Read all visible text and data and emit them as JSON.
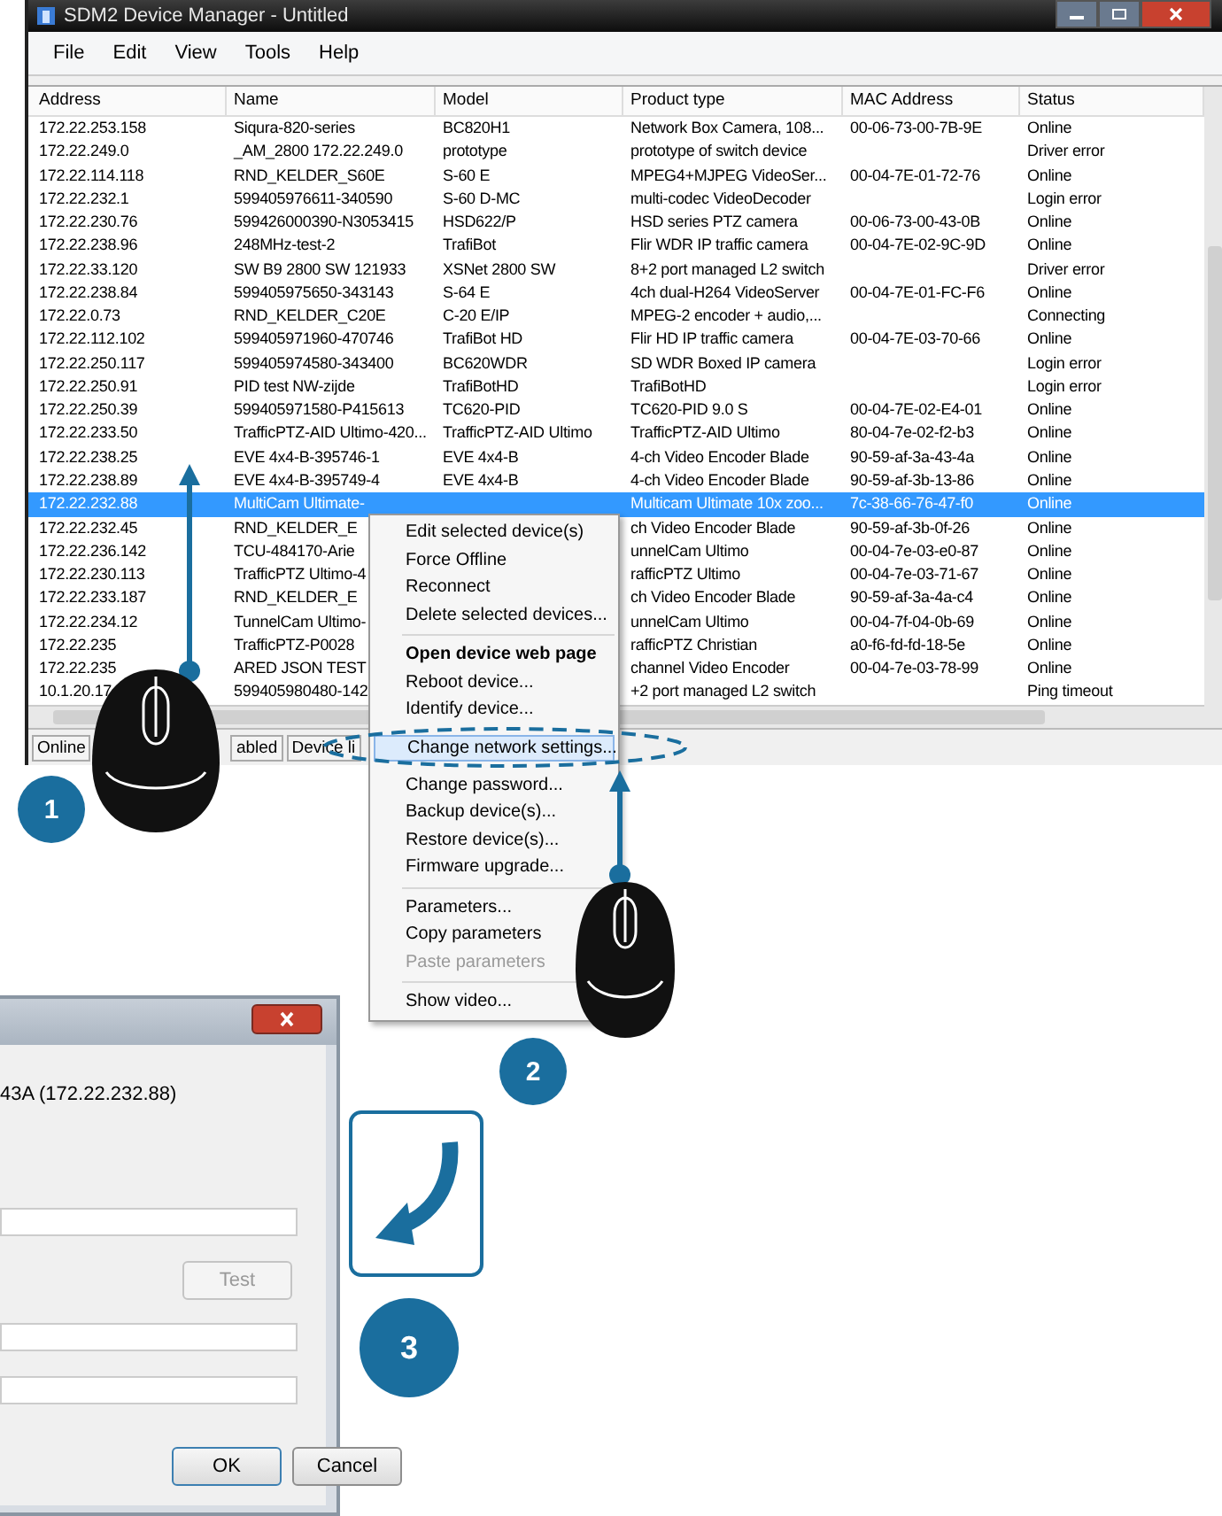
{
  "window": {
    "title": "SDM2 Device Manager - Untitled"
  },
  "menu": [
    "File",
    "Edit",
    "View",
    "Tools",
    "Help"
  ],
  "table": {
    "columns": [
      "Address",
      "Name",
      "Model",
      "Product type",
      "MAC Address",
      "Status"
    ],
    "rows": [
      {
        "cells": [
          "172.22.253.158",
          "Siqura-820-series",
          "BC820H1",
          "Network Box Camera, 108...",
          "00-06-73-00-7B-9E",
          "Online"
        ],
        "selected": false
      },
      {
        "cells": [
          "172.22.249.0",
          "_AM_2800  172.22.249.0",
          "prototype",
          "prototype of switch device",
          null,
          "Driver error"
        ],
        "selected": false
      },
      {
        "cells": [
          "172.22.114.118",
          "RND_KELDER_S60E",
          "S-60 E",
          "MPEG4+MJPEG VideoSer...",
          "00-04-7E-01-72-76",
          "Online"
        ],
        "selected": false
      },
      {
        "cells": [
          "172.22.232.1",
          "599405976611-340590",
          "S-60 D-MC",
          "multi-codec VideoDecoder",
          null,
          "Login error"
        ],
        "selected": false
      },
      {
        "cells": [
          "172.22.230.76",
          "599426000390-N3053415",
          "HSD622/P",
          "HSD series PTZ camera",
          "00-06-73-00-43-0B",
          "Online"
        ],
        "selected": false
      },
      {
        "cells": [
          "172.22.238.96",
          "248MHz-test-2",
          "TrafiBot",
          "Flir WDR IP traffic camera",
          "00-04-7E-02-9C-9D",
          "Online"
        ],
        "selected": false
      },
      {
        "cells": [
          "172.22.33.120",
          "SW B9 2800 SW 121933",
          "XSNet 2800 SW",
          "8+2 port managed L2 switch",
          null,
          "Driver error"
        ],
        "selected": false
      },
      {
        "cells": [
          "172.22.238.84",
          "599405975650-343143",
          "S-64 E",
          "4ch dual-H264 VideoServer",
          "00-04-7E-01-FC-F6",
          "Online"
        ],
        "selected": false
      },
      {
        "cells": [
          "172.22.0.73",
          "RND_KELDER_C20E",
          "C-20 E/IP",
          "MPEG-2 encoder + audio,...",
          null,
          "Connecting"
        ],
        "selected": false
      },
      {
        "cells": [
          "172.22.112.102",
          "599405971960-470746",
          "TrafiBot HD",
          "Flir HD IP traffic camera",
          "00-04-7E-03-70-66",
          "Online"
        ],
        "selected": false
      },
      {
        "cells": [
          "172.22.250.117",
          "599405974580-343400",
          "BC620WDR",
          "SD WDR Boxed IP camera",
          null,
          "Login error"
        ],
        "selected": false
      },
      {
        "cells": [
          "172.22.250.91",
          "PID test NW-zijde",
          "TrafiBotHD",
          "TrafiBotHD",
          null,
          "Login error"
        ],
        "selected": false
      },
      {
        "cells": [
          "172.22.250.39",
          "599405971580-P415613",
          "TC620-PID",
          "TC620-PID 9.0 S",
          "00-04-7E-02-E4-01",
          "Online"
        ],
        "selected": false
      },
      {
        "cells": [
          "172.22.233.50",
          "TrafficPTZ-AID Ultimo-420...",
          "TrafficPTZ-AID Ultimo",
          "TrafficPTZ-AID Ultimo",
          "80-04-7e-02-f2-b3",
          "Online"
        ],
        "selected": false
      },
      {
        "cells": [
          "172.22.238.25",
          "EVE 4x4-B-395746-1",
          "EVE 4x4-B",
          "4-ch Video Encoder Blade",
          "90-59-af-3a-43-4a",
          "Online"
        ],
        "selected": false
      },
      {
        "cells": [
          "172.22.238.89",
          "EVE 4x4-B-395749-4",
          "EVE 4x4-B",
          "4-ch Video Encoder Blade",
          "90-59-af-3b-13-86",
          "Online"
        ],
        "selected": false
      },
      {
        "cells": [
          "172.22.232.88",
          "MultiCam Ultimate-",
          null,
          "Multicam Ultimate 10x zoo...",
          "7c-38-66-76-47-f0",
          "Online"
        ],
        "selected": true
      },
      {
        "cells": [
          "172.22.232.45",
          "RND_KELDER_E",
          null,
          "ch Video Encoder Blade",
          "90-59-af-3b-0f-26",
          "Online"
        ],
        "selected": false
      },
      {
        "cells": [
          "172.22.236.142",
          "TCU-484170-Arie",
          null,
          "unnelCam Ultimo",
          "00-04-7e-03-e0-87",
          "Online"
        ],
        "selected": false
      },
      {
        "cells": [
          "172.22.230.113",
          "TrafficPTZ Ultimo-4",
          null,
          "rafficPTZ Ultimo",
          "00-04-7e-03-71-67",
          "Online"
        ],
        "selected": false
      },
      {
        "cells": [
          "172.22.233.187",
          "RND_KELDER_E",
          null,
          "ch Video Encoder Blade",
          "90-59-af-3a-4a-c4",
          "Online"
        ],
        "selected": false
      },
      {
        "cells": [
          "172.22.234.12",
          "TunnelCam Ultimo-",
          null,
          "unnelCam Ultimo",
          "00-04-7f-04-0b-69",
          "Online"
        ],
        "selected": false
      },
      {
        "cells": [
          "172.22.235",
          "TrafficPTZ-P0028",
          null,
          "rafficPTZ Christian",
          "a0-f6-fd-fd-18-5e",
          "Online"
        ],
        "selected": false
      },
      {
        "cells": [
          "172.22.235",
          "ARED JSON TEST",
          null,
          "channel Video Encoder",
          "00-04-7e-03-78-99",
          "Online"
        ],
        "selected": false
      },
      {
        "cells": [
          "10.1.20.17",
          "599405980480-142",
          null,
          "+2 port managed L2 switch",
          null,
          "Ping timeout"
        ],
        "selected": false
      }
    ]
  },
  "status_bar": [
    "Online",
    "abled",
    "Device li"
  ],
  "context_menu": [
    {
      "kind": "item",
      "label": "Edit selected device(s)",
      "default": false,
      "disabled": false,
      "selected": false
    },
    {
      "kind": "item",
      "label": "Force Offline",
      "default": false,
      "disabled": false,
      "selected": false
    },
    {
      "kind": "item",
      "label": "Reconnect",
      "default": false,
      "disabled": false,
      "selected": false
    },
    {
      "kind": "item",
      "label": "Delete selected devices...",
      "default": false,
      "disabled": false,
      "selected": false
    },
    {
      "kind": "separator"
    },
    {
      "kind": "item",
      "label": "Open device web page",
      "default": true,
      "disabled": false,
      "selected": false
    },
    {
      "kind": "item",
      "label": "Reboot device...",
      "default": false,
      "disabled": false,
      "selected": false
    },
    {
      "kind": "item",
      "label": "Identify device...",
      "default": false,
      "disabled": false,
      "selected": false
    },
    {
      "kind": "item",
      "label": "Change network settings...",
      "default": false,
      "disabled": false,
      "selected": true
    },
    {
      "kind": "item",
      "label": "Change password...",
      "default": false,
      "disabled": false,
      "selected": false
    },
    {
      "kind": "item",
      "label": "Backup device(s)...",
      "default": false,
      "disabled": false,
      "selected": false
    },
    {
      "kind": "item",
      "label": "Restore device(s)...",
      "default": false,
      "disabled": false,
      "selected": false
    },
    {
      "kind": "item",
      "label": "Firmware upgrade...",
      "default": false,
      "disabled": false,
      "selected": false
    },
    {
      "kind": "separator"
    },
    {
      "kind": "item",
      "label": "Parameters...",
      "default": false,
      "disabled": false,
      "selected": false
    },
    {
      "kind": "item",
      "label": "Copy parameters",
      "default": false,
      "disabled": false,
      "selected": false
    },
    {
      "kind": "item",
      "label": "Paste parameters",
      "default": false,
      "disabled": true,
      "selected": false
    },
    {
      "kind": "separator"
    },
    {
      "kind": "item",
      "label": "Show video...",
      "default": false,
      "disabled": false,
      "selected": false
    }
  ],
  "dialog": {
    "device_text": "43A (172.22.232.88)",
    "test_button": {
      "label": "Test",
      "disabled": true
    },
    "buttons": [
      {
        "label": "OK",
        "default": true
      },
      {
        "label": "Cancel",
        "default": false
      }
    ]
  },
  "steps": [
    "1",
    "2",
    "3"
  ]
}
